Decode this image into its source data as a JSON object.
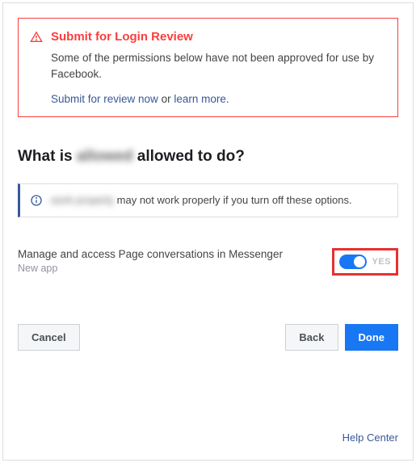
{
  "alert": {
    "title": "Submit for Login Review",
    "body": "Some of the permissions below have not been approved for use by Facebook.",
    "submit_link": "Submit for review now",
    "or_text": " or ",
    "learn_link": "learn more",
    "period": "."
  },
  "heading": {
    "prefix": "What is ",
    "blurred": "allowed",
    "suffix": " allowed to do?"
  },
  "info": {
    "blurred": "work properly",
    "text": " may not work properly if you turn off these options."
  },
  "permission": {
    "label": "Manage and access Page conversations in Messenger",
    "sub": "New app",
    "toggle_state": "YES"
  },
  "buttons": {
    "cancel": "Cancel",
    "back": "Back",
    "done": "Done"
  },
  "footer": {
    "help": "Help Center"
  }
}
